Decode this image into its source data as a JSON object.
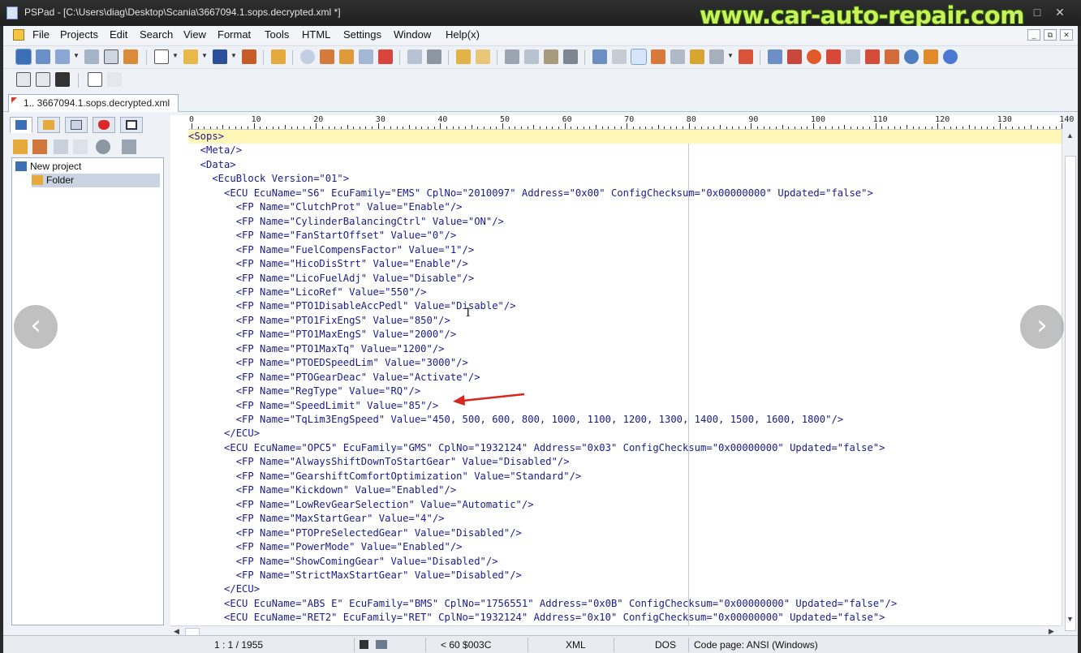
{
  "window": {
    "title": "PSPad - [C:\\Users\\diag\\Desktop\\Scania\\3667094.1.sops.decrypted.xml *]",
    "watermark": "www.car-auto-repair.com",
    "controls": [
      "–",
      "□",
      "✕"
    ]
  },
  "menu": [
    "File",
    "Projects",
    "Edit",
    "Search",
    "View",
    "Format",
    "Tools",
    "HTML",
    "Settings",
    "Window",
    "Help(x)"
  ],
  "mdi_controls": [
    "_",
    "⧉",
    "✕"
  ],
  "tab": {
    "label": "1.. 3667094.1.sops.decrypted.xml"
  },
  "project": {
    "tree": [
      {
        "label": "New project",
        "icon": "project-icon"
      },
      {
        "label": "Folder",
        "icon": "folder-icon",
        "selected": true
      }
    ]
  },
  "ruler": {
    "labels": [
      "0",
      "10",
      "20",
      "30",
      "40",
      "50",
      "60",
      "70",
      "80",
      "90",
      "100",
      "110",
      "120",
      "130",
      "140"
    ]
  },
  "code_lines": [
    "<Sops>",
    "  <Meta/>",
    "  <Data>",
    "    <EcuBlock Version=\"01\">",
    "      <ECU EcuName=\"S6\" EcuFamily=\"EMS\" CplNo=\"2010097\" Address=\"0x00\" ConfigChecksum=\"0x00000000\" Updated=\"false\">",
    "        <FP Name=\"ClutchProt\" Value=\"Enable\"/>",
    "        <FP Name=\"CylinderBalancingCtrl\" Value=\"ON\"/>",
    "        <FP Name=\"FanStartOffset\" Value=\"0\"/>",
    "        <FP Name=\"FuelCompensFactor\" Value=\"1\"/>",
    "        <FP Name=\"HicoDisStrt\" Value=\"Enable\"/>",
    "        <FP Name=\"LicoFuelAdj\" Value=\"Disable\"/>",
    "        <FP Name=\"LicoRef\" Value=\"550\"/>",
    "        <FP Name=\"PTO1DisableAccPedl\" Value=\"Disable\"/>",
    "        <FP Name=\"PTO1FixEngS\" Value=\"850\"/>",
    "        <FP Name=\"PTO1MaxEngS\" Value=\"2000\"/>",
    "        <FP Name=\"PTO1MaxTq\" Value=\"1200\"/>",
    "        <FP Name=\"PTOEDSpeedLim\" Value=\"3000\"/>",
    "        <FP Name=\"PTOGearDeac\" Value=\"Activate\"/>",
    "        <FP Name=\"RegType\" Value=\"RQ\"/>",
    "        <FP Name=\"SpeedLimit\" Value=\"85\"/>",
    "        <FP Name=\"TqLim3EngSpeed\" Value=\"450, 500, 600, 800, 1000, 1100, 1200, 1300, 1400, 1500, 1600, 1800\"/>",
    "      </ECU>",
    "      <ECU EcuName=\"OPC5\" EcuFamily=\"GMS\" CplNo=\"1932124\" Address=\"0x03\" ConfigChecksum=\"0x00000000\" Updated=\"false\">",
    "        <FP Name=\"AlwaysShiftDownToStartGear\" Value=\"Disabled\"/>",
    "        <FP Name=\"GearshiftComfortOptimization\" Value=\"Standard\"/>",
    "        <FP Name=\"Kickdown\" Value=\"Enabled\"/>",
    "        <FP Name=\"LowRevGearSelection\" Value=\"Automatic\"/>",
    "        <FP Name=\"MaxStartGear\" Value=\"4\"/>",
    "        <FP Name=\"PTOPreSelectedGear\" Value=\"Disabled\"/>",
    "        <FP Name=\"PowerMode\" Value=\"Enabled\"/>",
    "        <FP Name=\"ShowComingGear\" Value=\"Disabled\"/>",
    "        <FP Name=\"StrictMaxStartGear\" Value=\"Disabled\"/>",
    "      </ECU>",
    "      <ECU EcuName=\"ABS E\" EcuFamily=\"BMS\" CplNo=\"1756551\" Address=\"0x0B\" ConfigChecksum=\"0x00000000\" Updated=\"false\"/>",
    "      <ECU EcuName=\"RET2\" EcuFamily=\"RET\" CplNo=\"1932124\" Address=\"0x10\" ConfigChecksum=\"0x00000000\" Updated=\"false\">"
  ],
  "status": {
    "position": "1 : 1 / 1955",
    "char": "<  60  $003C",
    "syntax": "XML",
    "line_end": "DOS",
    "codepage": "Code page: ANSI (Windows)"
  },
  "overlay": {
    "prev": "‹",
    "next": "›"
  },
  "colors": {
    "tag": "#1a1a8c",
    "current_line": "#fff6b8",
    "annotation_arrow": "#d9251c",
    "watermark": "#c8f15a"
  }
}
